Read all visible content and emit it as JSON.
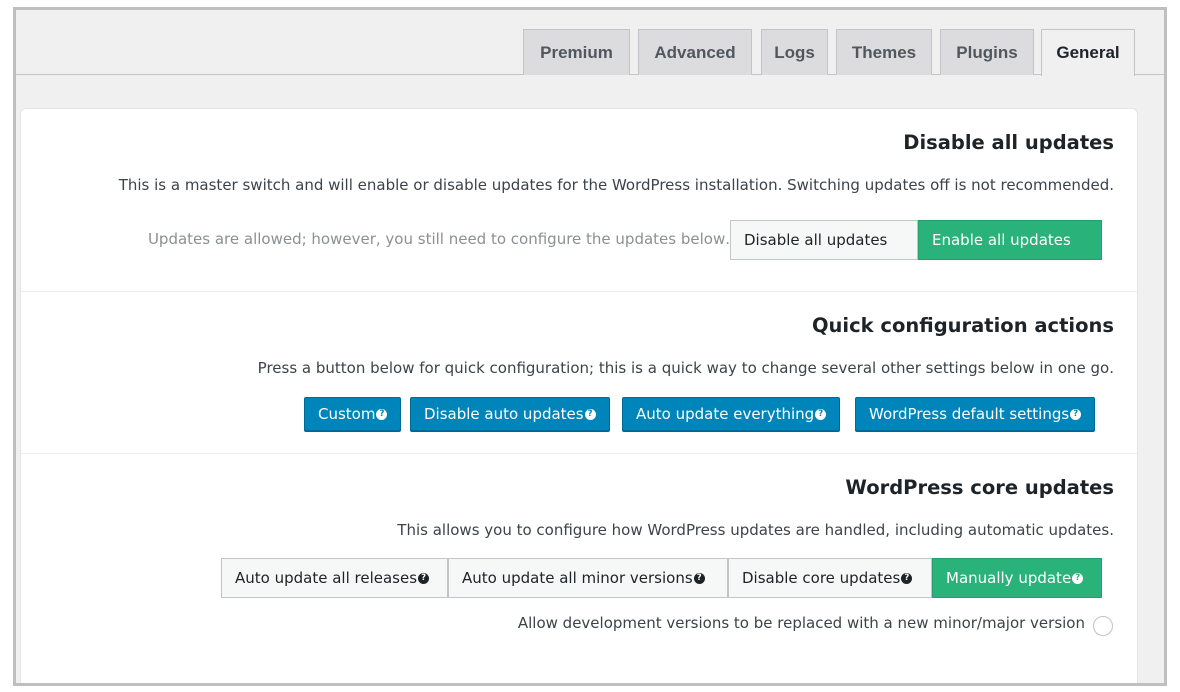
{
  "tabs": [
    "Premium",
    "Advanced",
    "Logs",
    "Themes",
    "Plugins",
    "General"
  ],
  "active_tab": "General",
  "sections": {
    "master": {
      "title": "Disable all updates",
      "description": ".This is a master switch and will enable or disable updates for the WordPress installation. Switching updates off is not recommended",
      "status": ".Updates are allowed; however, you still need to configure the updates below",
      "disable_label": "Disable all updates",
      "enable_label": "Enable all updates"
    },
    "quick": {
      "title": "Quick configuration actions",
      "description": ".Press a button below for quick configuration; this is a quick way to change several other settings below in one go",
      "buttons": [
        "Custom",
        "Disable auto updates",
        "Auto update everything",
        "WordPress default settings"
      ]
    },
    "core": {
      "title": "WordPress core updates",
      "description": ".This allows you to configure how WordPress updates are handled, including automatic updates",
      "options": [
        "Auto update all releases",
        "Auto update all minor versions",
        "Disable core updates",
        "Manually update"
      ],
      "selected_option": "Manually update",
      "dev_versions_label": "Allow development versions to be replaced with a new minor/major version",
      "dev_versions_checked": false
    }
  },
  "help_icon_glyph": "?",
  "colors": {
    "green": "#2ab27b",
    "blue": "#0085ba"
  }
}
